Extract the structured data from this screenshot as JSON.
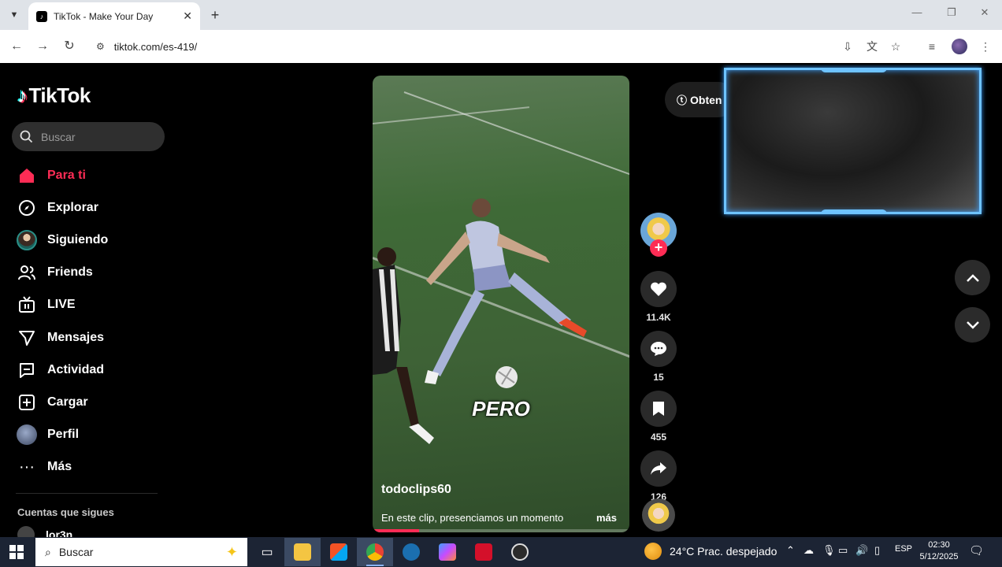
{
  "browser": {
    "tab_title": "TikTok - Make Your Day",
    "url": "tiktok.com/es-419/"
  },
  "sidebar": {
    "logo_text": "TikTok",
    "search_placeholder": "Buscar",
    "items": [
      {
        "label": "Para ti",
        "icon": "home-icon",
        "active": true
      },
      {
        "label": "Explorar",
        "icon": "compass-icon"
      },
      {
        "label": "Siguiendo",
        "icon": "following-avatar-icon"
      },
      {
        "label": "Friends",
        "icon": "friends-icon"
      },
      {
        "label": "LIVE",
        "icon": "live-tv-icon"
      },
      {
        "label": "Mensajes",
        "icon": "send-icon"
      },
      {
        "label": "Actividad",
        "icon": "activity-icon"
      },
      {
        "label": "Cargar",
        "icon": "upload-plus-icon"
      },
      {
        "label": "Perfil",
        "icon": "profile-avatar-icon"
      },
      {
        "label": "Más",
        "icon": "more-dots-icon"
      }
    ],
    "following_title": "Cuentas que sigues",
    "following": [
      {
        "name": "lor3n"
      }
    ]
  },
  "video": {
    "caption_overlay": "PERO",
    "author": "todoclips60",
    "description": "En este clip, presenciamos un momento",
    "more_label": "más",
    "progress": 0.18
  },
  "actions": {
    "likes": "11.4K",
    "comments": "15",
    "saves": "455",
    "shares": "126"
  },
  "get_app_label": "Obten",
  "taskbar": {
    "search_text": "Buscar",
    "weather": "24°C  Prac. despejado",
    "language": "ESP",
    "time": "02:30",
    "date": "5/12/2025"
  },
  "colors": {
    "accent": "#fe2c55",
    "background": "#000000"
  }
}
